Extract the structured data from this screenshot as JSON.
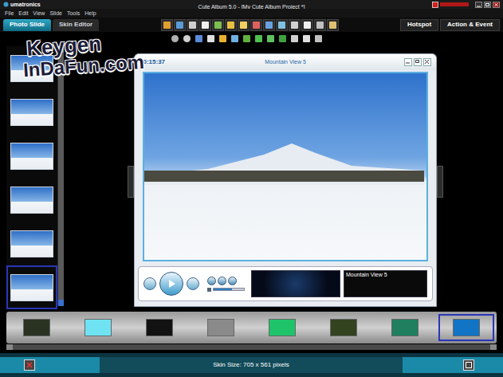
{
  "window": {
    "brand": "umatronics",
    "title": "Cute Album 5.0 - [My Cute Album Project *]"
  },
  "menu": [
    "File",
    "Edit",
    "View",
    "Slide",
    "Tools",
    "Help"
  ],
  "tabs": [
    {
      "label": "Photo Slide",
      "selected": true
    },
    {
      "label": "Skin Editor",
      "selected": false
    }
  ],
  "right_tabs": [
    {
      "label": "Hotspot",
      "selected": false
    },
    {
      "label": "Action & Event",
      "selected": false
    }
  ],
  "thumbnails": [
    {
      "selected": false
    },
    {
      "selected": false
    },
    {
      "selected": false
    },
    {
      "selected": false
    },
    {
      "selected": false
    },
    {
      "selected": true
    }
  ],
  "preview": {
    "time": "00:15:37",
    "title": "Mountain View 5",
    "caption": "Mountain View 5",
    "volume": {
      "level": 0.6
    }
  },
  "skins": [
    {
      "color": "#2a3322",
      "selected": false
    },
    {
      "color": "#6fe3f2",
      "selected": false
    },
    {
      "color": "#121212",
      "selected": false
    },
    {
      "color": "#8a8a8a",
      "selected": false
    },
    {
      "color": "#1fc36a",
      "selected": false
    },
    {
      "color": "#33431f",
      "selected": false
    },
    {
      "color": "#1f7f5e",
      "selected": false
    },
    {
      "color": "#1274c4",
      "selected": true
    }
  ],
  "status_bar": {
    "text": "Skin Size: 705 x 561 pixels"
  },
  "watermark": [
    "Keygen",
    "InDaFun.com"
  ]
}
